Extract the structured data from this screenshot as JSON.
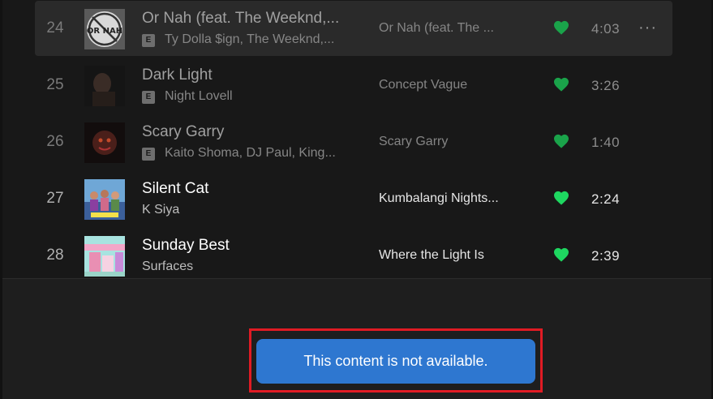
{
  "tracks": [
    {
      "number": "24",
      "title": "Or Nah (feat. The Weeknd,...",
      "explicit_badge": "E",
      "artists": "Ty Dolla $ign, The Weeknd,...",
      "album": "Or Nah (feat. The ...",
      "liked": true,
      "duration": "4:03",
      "more_label": "···",
      "cover_text": "OR NAH",
      "state": "hovered"
    },
    {
      "number": "25",
      "title": "Dark Light",
      "explicit_badge": "E",
      "artists": "Night Lovell",
      "album": "Concept Vague",
      "liked": true,
      "duration": "3:26",
      "state": "unavailable"
    },
    {
      "number": "26",
      "title": "Scary Garry",
      "explicit_badge": "E",
      "artists": "Kaito Shoma, DJ Paul, King...",
      "album": "Scary Garry",
      "liked": true,
      "duration": "1:40",
      "state": "unavailable"
    },
    {
      "number": "27",
      "title": "Silent Cat",
      "artists": "K Siya",
      "album": "Kumbalangi Nights...",
      "liked": true,
      "duration": "2:24",
      "state": "available"
    },
    {
      "number": "28",
      "title": "Sunday Best",
      "artists": "Surfaces",
      "album": "Where the Light Is",
      "liked": true,
      "duration": "2:39",
      "state": "available"
    }
  ],
  "toast": {
    "message": "This content is not available."
  },
  "colors": {
    "liked_heart": "#1ed760",
    "toast_background": "#2e77d0",
    "highlight_border": "#e01b24"
  },
  "icons": {
    "heart": "heart-icon",
    "more": "more-options-icon",
    "explicit": "explicit-badge"
  }
}
